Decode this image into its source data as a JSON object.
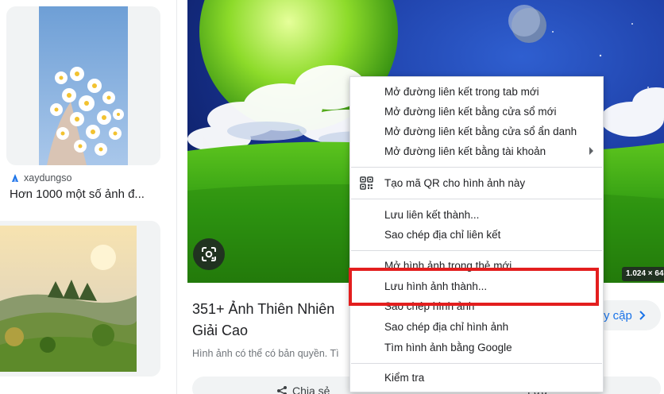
{
  "left_results": {
    "card1": {
      "source_name": "xaydungso",
      "title": "Hơn 1000 một số ảnh đ..."
    }
  },
  "preview": {
    "dimensions_badge": "1.024 × 64",
    "title": "351+ Ảnh Thiên Nhiên Giải Cao",
    "copyright_note": "Hình ảnh có thể có bản quyền. Tì",
    "visit_button_label": "y cập",
    "share_label": "Chia sẻ",
    "save_label": "Lưu"
  },
  "context_menu": {
    "items": [
      "Mở đường liên kết trong tab mới",
      "Mở đường liên kết bằng cửa sổ mới",
      "Mở đường liên kết bằng cửa sổ ẩn danh",
      "Mở đường liên kết bằng tài khoản",
      "Tạo mã QR cho hình ảnh này",
      "Lưu liên kết thành...",
      "Sao chép địa chỉ liên kết",
      "Mở hình ảnh trong thẻ mới",
      "Lưu hình ảnh thành...",
      "Sao chép hình ảnh",
      "Sao chép địa chỉ hình ảnh",
      "Tìm hình ảnh bằng Google",
      "Kiểm tra"
    ],
    "submenu_arrow_icon": "triangle-right-icon",
    "qr_icon": "qr-code-icon",
    "highlight_color": "#e31e1e"
  },
  "icons": {
    "lens": "google-lens-icon",
    "source": "xaydungso-logo-icon",
    "share": "share-icon",
    "visit": "chevron-right-icon"
  },
  "colors": {
    "link_blue": "#1a73e8",
    "menu_border": "#dadce0",
    "card_bg": "#f1f3f4"
  }
}
